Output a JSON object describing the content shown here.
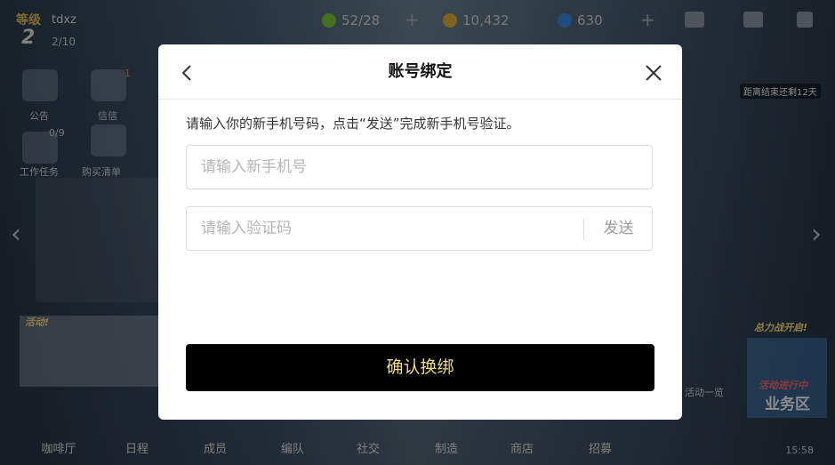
{
  "player": {
    "level_label": "等级",
    "level": "2",
    "name": "tdxz",
    "exp": "2/10"
  },
  "resources": [
    {
      "icon": "energy-icon",
      "value": "52/28",
      "color": "#7fce3a"
    },
    {
      "icon": "gold-coin-icon",
      "value": "10,432",
      "color": "#e6b93a"
    },
    {
      "icon": "gem-icon",
      "value": "630",
      "color": "#3a8fe6"
    }
  ],
  "sidebar": {
    "announcement": "公告",
    "letters": "信信",
    "letters_badge": "1",
    "tasks": "工作任务",
    "tasks_progress": "0/9",
    "purchase": "购买清单"
  },
  "banner": {
    "event_tag": "活动!",
    "countdown": "距离结束还剩12天",
    "battle_tag": "总力战开启!",
    "activity_list": "活动一览",
    "event_ongoing": "活动进行中",
    "business_area": "业务区"
  },
  "bottom_nav": [
    "咖啡厅",
    "日程",
    "成员",
    "编队",
    "社交",
    "制造",
    "商店",
    "招募"
  ],
  "clock": "15:58",
  "dialog": {
    "title": "账号绑定",
    "instruction": "请输入你的新手机号码，点击“发送”完成新手机号验证。",
    "phone_placeholder": "请输入新手机号",
    "code_placeholder": "请输入验证码",
    "send_label": "发送",
    "confirm_label": "确认换绑"
  },
  "colors": {
    "confirm_bg": "#000000",
    "confirm_text": "#f1dc7e"
  }
}
